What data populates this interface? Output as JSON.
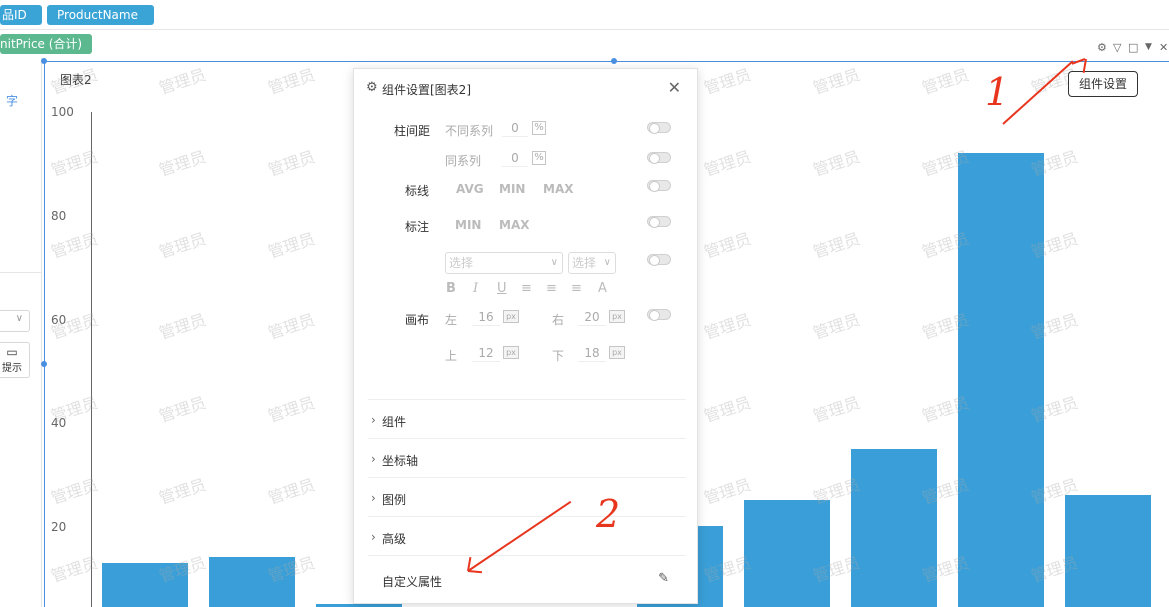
{
  "topbar": {
    "field1": "品ID",
    "field2": "ProductName",
    "measure": "nitPrice (合计)"
  },
  "sidebar": {
    "char_label": "字",
    "tip_label": "提示",
    "tip_icon": "speech-bubble-icon"
  },
  "chart": {
    "title": "图表2",
    "y_ticks": [
      "100",
      "80",
      "60",
      "40",
      "20"
    ]
  },
  "toolbar": {
    "settings_icon": "gear-icon",
    "filter_icon": "filter-icon",
    "maximize_icon": "square-icon",
    "dropdown_icon": "caret-down-icon",
    "close_icon": "close-icon",
    "tooltip": "组件设置"
  },
  "panel": {
    "title": "组件设置[图表2]",
    "bar_spacing_label": "柱间距",
    "diff_series_label": "不同系列",
    "diff_series_value": "0",
    "same_series_label": "同系列",
    "same_series_value": "0",
    "percent": "%",
    "mark_line_label": "标线",
    "mark_line_opts": [
      "AVG",
      "MIN",
      "MAX"
    ],
    "annotate_label": "标注",
    "annotate_opts": [
      "MIN",
      "MAX"
    ],
    "font_select_placeholder": "选择",
    "size_select_placeholder": "选择",
    "format_buttons": [
      "B",
      "I",
      "U",
      "≡",
      "≡",
      "≡",
      "A"
    ],
    "canvas_label": "画布",
    "left_label": "左",
    "left_value": "16",
    "right_label": "右",
    "right_value": "20",
    "top_label": "上",
    "top_value": "12",
    "bottom_label": "下",
    "bottom_value": "18",
    "px": "px",
    "sections": [
      "组件",
      "坐标轴",
      "图例",
      "高级"
    ],
    "custom_attr": "自定义属性"
  },
  "annotations": {
    "mark1": "1",
    "mark2": "2"
  },
  "watermark": "管理员",
  "chart_data": {
    "type": "bar",
    "title": "图表2",
    "ylim": [
      0,
      100
    ],
    "y_ticks": [
      20,
      40,
      60,
      80,
      100
    ],
    "values": [
      13,
      14,
      5,
      4,
      4,
      20,
      25,
      35,
      92,
      26
    ],
    "color": "#3a9fd8",
    "grid": false
  },
  "colors": {
    "accent": "#4a90e2",
    "bar": "#3a9fd8",
    "pill_blue": "#3ba4d6",
    "pill_green": "#5cb88f",
    "annotation_red": "#e8351e"
  }
}
